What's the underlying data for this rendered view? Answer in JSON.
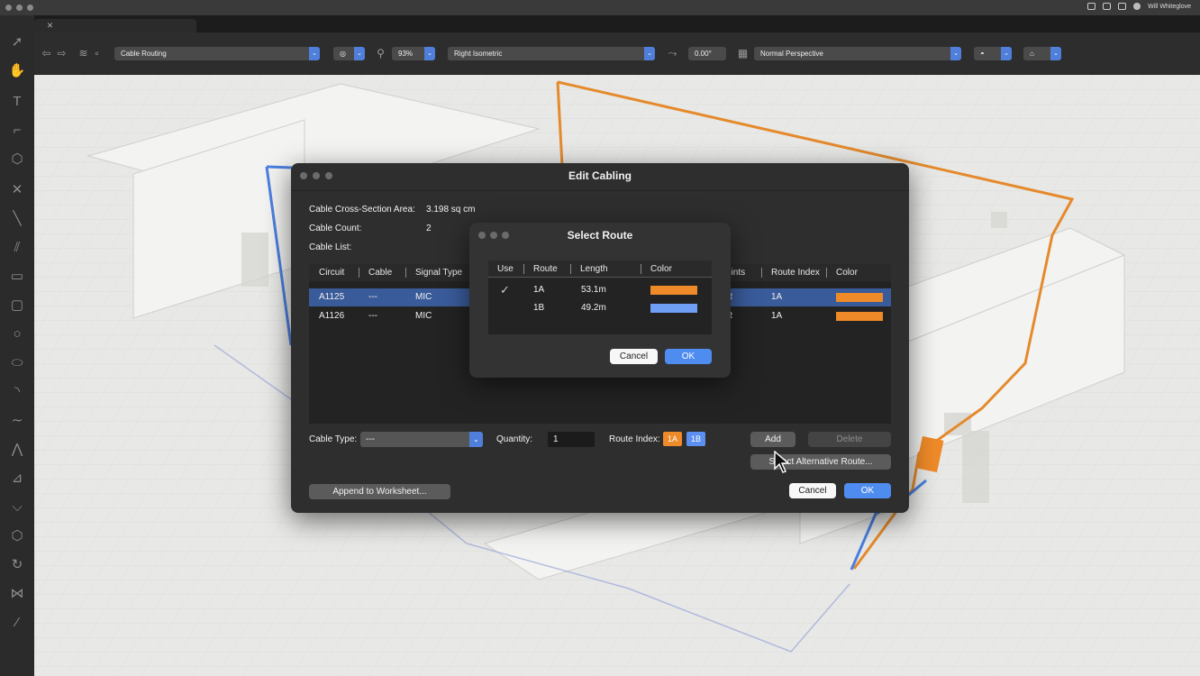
{
  "menubar": {
    "user_name": "Will Whiteglove"
  },
  "toolbar": {
    "class_select": "Cable Routing",
    "zoom": "93%",
    "view_select": "Right Isometric",
    "angle": "0.00°",
    "perspective_select": "Normal Perspective"
  },
  "edit_cabling": {
    "title": "Edit Cabling",
    "cross_section_label": "Cable Cross-Section Area:",
    "cross_section_value": "3.198 sq cm",
    "cable_count_label": "Cable Count:",
    "cable_count_value": "2",
    "cable_list_label": "Cable List:",
    "columns": {
      "circuit": "Circuit",
      "cable": "Cable",
      "signal_type": "Signal Type",
      "points": "oints",
      "route_index": "Route Index",
      "color": "Color"
    },
    "rows": [
      {
        "circuit": "A1125",
        "cable": "---",
        "signal_type": "MIC",
        "points": "R",
        "route_index": "1A",
        "color": "#ee8a28"
      },
      {
        "circuit": "A1126",
        "cable": "---",
        "signal_type": "MIC",
        "points": "R",
        "route_index": "1A",
        "color": "#ee8a28"
      }
    ],
    "cable_type_label": "Cable Type:",
    "cable_type_value": "---",
    "quantity_label": "Quantity:",
    "quantity_value": "1",
    "route_index_label": "Route Index:",
    "route_chip_1": "1A",
    "route_chip_2": "1B",
    "add_label": "Add",
    "delete_label": "Delete",
    "select_alt_route_label": "Select Alternative Route...",
    "append_label": "Append to Worksheet...",
    "cancel_label": "Cancel",
    "ok_label": "OK"
  },
  "select_route": {
    "title": "Select Route",
    "columns": {
      "use": "Use",
      "route": "Route",
      "length": "Length",
      "color": "Color"
    },
    "rows": [
      {
        "use": "✓",
        "route": "1A",
        "length": "53.1m",
        "color": "#ee8a28"
      },
      {
        "use": "",
        "route": "1B",
        "length": "49.2m",
        "color": "#6f9ef5"
      }
    ],
    "cancel_label": "Cancel",
    "ok_label": "OK"
  },
  "colors": {
    "orange_route": "#e58a2c",
    "blue_route": "#4b7fe0",
    "accent": "#4f8cf0"
  }
}
